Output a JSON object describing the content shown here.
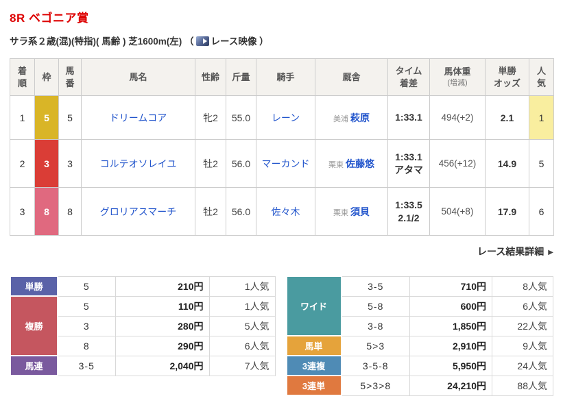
{
  "colors": {
    "title_red": "#dd0000",
    "link_blue": "#2255cc",
    "header_bg": "#f4f2ee",
    "border_gray": "#cccccc"
  },
  "header": {
    "race_title": "8R ベゴニア賞",
    "conditions_prefix": "サラ系２歳(混)(特指)( 馬齢 ) 芝1600m(左)",
    "paren_open": "（",
    "video_label": "レース映像",
    "paren_close": "）"
  },
  "results_table": {
    "headers": {
      "finish": "着\n順",
      "frame": "枠",
      "number": "馬\n番",
      "horse": "馬名",
      "sex_age": "性齢",
      "weight": "斤量",
      "jockey": "騎手",
      "stable": "厩舎",
      "time_margin": "タイム\n着差",
      "horse_weight": "馬体重",
      "horse_weight_sub": "(増減)",
      "odds": "単勝\nオッズ",
      "favorite": "人\n気"
    },
    "rows": [
      {
        "finish": "1",
        "frame": "5",
        "frame_color": "#d9b527",
        "number": "5",
        "horse": "ドリームコア",
        "sex_age": "牝2",
        "weight": "55.0",
        "jockey": "レーン",
        "stable_region": "美浦",
        "stable_trainer": "萩原",
        "time": "1:33.1",
        "margin": "",
        "horse_weight": "494(+2)",
        "odds": "2.1",
        "favorite": "1",
        "favorite_bg": "#f9ee9f"
      },
      {
        "finish": "2",
        "frame": "3",
        "frame_color": "#da3d36",
        "number": "3",
        "horse": "コルテオソレイユ",
        "sex_age": "牡2",
        "weight": "56.0",
        "jockey": "マーカンド",
        "stable_region": "栗東",
        "stable_trainer": "佐藤悠",
        "time": "1:33.1",
        "margin": "アタマ",
        "horse_weight": "456(+12)",
        "odds": "14.9",
        "favorite": "5",
        "favorite_bg": ""
      },
      {
        "finish": "3",
        "frame": "8",
        "frame_color": "#e0697f",
        "number": "8",
        "horse": "グロリアスマーチ",
        "sex_age": "牡2",
        "weight": "56.0",
        "jockey": "佐々木",
        "stable_region": "栗東",
        "stable_trainer": "須貝",
        "time": "1:33.5",
        "margin": "2.1/2",
        "horse_weight": "504(+8)",
        "odds": "17.9",
        "favorite": "6",
        "favorite_bg": ""
      }
    ]
  },
  "detail_link": {
    "label": "レース結果詳細",
    "icon": "▶"
  },
  "payouts_left": {
    "groups": [
      {
        "type": "単勝",
        "color": "#5a62a8",
        "rows": [
          {
            "combo": "5",
            "amount": "210円",
            "pop": "1人気"
          }
        ]
      },
      {
        "type": "複勝",
        "color": "#c5565f",
        "rows": [
          {
            "combo": "5",
            "amount": "110円",
            "pop": "1人気"
          },
          {
            "combo": "3",
            "amount": "280円",
            "pop": "5人気"
          },
          {
            "combo": "8",
            "amount": "290円",
            "pop": "6人気"
          }
        ]
      },
      {
        "type": "馬連",
        "color": "#7a5a9e",
        "rows": [
          {
            "combo": "3-5",
            "amount": "2,040円",
            "pop": "7人気"
          }
        ]
      }
    ]
  },
  "payouts_right": {
    "groups": [
      {
        "type": "ワイド",
        "color": "#4a9ba0",
        "rows": [
          {
            "combo": "3-5",
            "amount": "710円",
            "pop": "8人気"
          },
          {
            "combo": "5-8",
            "amount": "600円",
            "pop": "6人気"
          },
          {
            "combo": "3-8",
            "amount": "1,850円",
            "pop": "22人気"
          }
        ]
      },
      {
        "type": "馬単",
        "color": "#e5a33b",
        "rows": [
          {
            "combo": "5>3",
            "amount": "2,910円",
            "pop": "9人気"
          }
        ]
      },
      {
        "type": "3連複",
        "color": "#4f8bb5",
        "rows": [
          {
            "combo": "3-5-8",
            "amount": "5,950円",
            "pop": "24人気"
          }
        ]
      },
      {
        "type": "3連単",
        "color": "#e0793f",
        "rows": [
          {
            "combo": "5>3>8",
            "amount": "24,210円",
            "pop": "88人気"
          }
        ]
      }
    ]
  }
}
